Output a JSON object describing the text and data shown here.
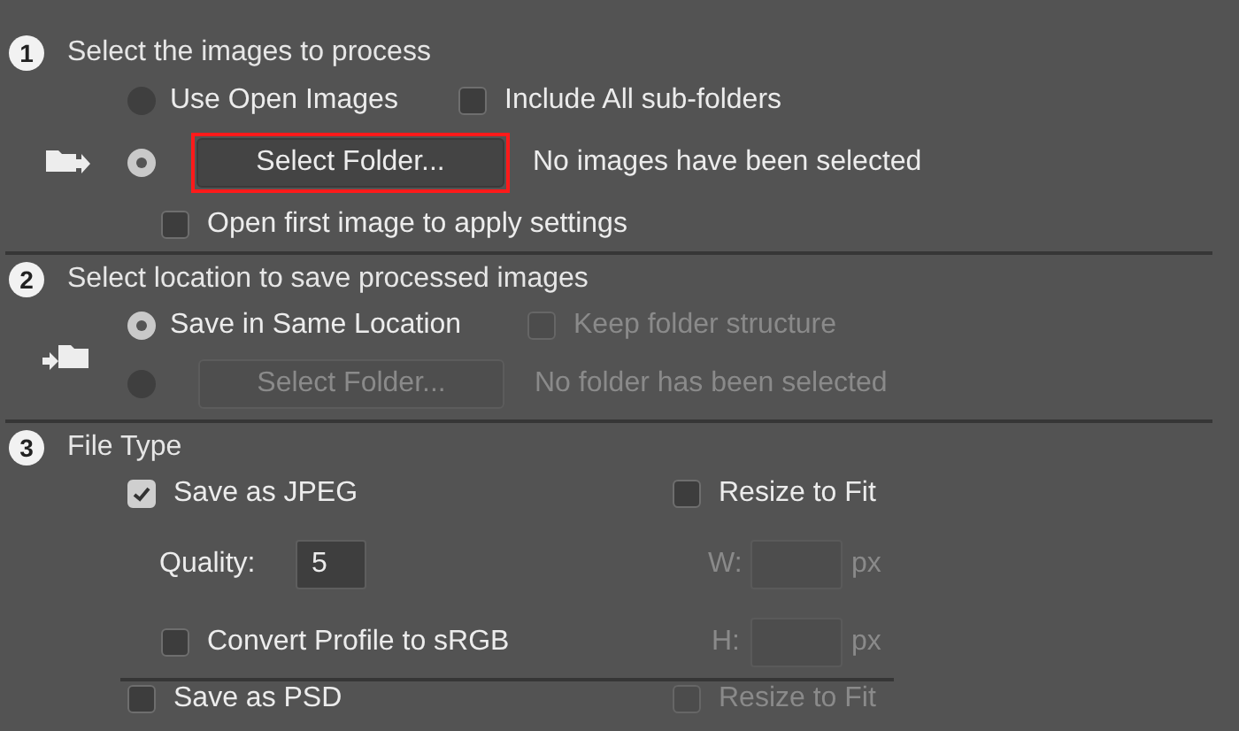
{
  "source": {
    "number": "1",
    "title": "Select the images to process",
    "options": [
      {
        "label": "Use Open Images",
        "selected": false
      },
      {
        "selected": true
      }
    ],
    "include_subfolders": {
      "label": "Include All sub-folders",
      "checked": false
    },
    "select_button": {
      "label": "Select Folder...",
      "highlighted": true,
      "disabled": false
    },
    "status": "No images have been selected",
    "open_first": {
      "label": "Open first image to apply settings",
      "checked": false
    }
  },
  "destination": {
    "number": "2",
    "title": "Select location to save processed images",
    "options": [
      {
        "label": "Save in Same Location",
        "selected": true
      },
      {
        "selected": false
      }
    ],
    "keep_structure": {
      "label": "Keep folder structure",
      "checked": false,
      "disabled": true
    },
    "select_button": {
      "label": "Select Folder...",
      "highlighted": false,
      "disabled": true
    },
    "status": "No folder has been selected",
    "status_disabled": true
  },
  "file_type": {
    "number": "3",
    "title": "File Type",
    "jpeg": {
      "label": "Save as JPEG",
      "checked": true
    },
    "resize": {
      "label": "Resize to Fit",
      "checked": false,
      "disabled": false
    },
    "quality": {
      "label": "Quality:",
      "value": "5"
    },
    "width": {
      "label": "W:",
      "unit": "px",
      "disabled": true
    },
    "height": {
      "label": "H:",
      "unit": "px",
      "disabled": true
    },
    "convert_profile": {
      "label": "Convert Profile to sRGB",
      "checked": false
    },
    "psd": {
      "label": "Save as PSD",
      "checked": false
    },
    "psd_resize": {
      "label": "Resize to Fit",
      "checked": false,
      "disabled": true
    }
  }
}
